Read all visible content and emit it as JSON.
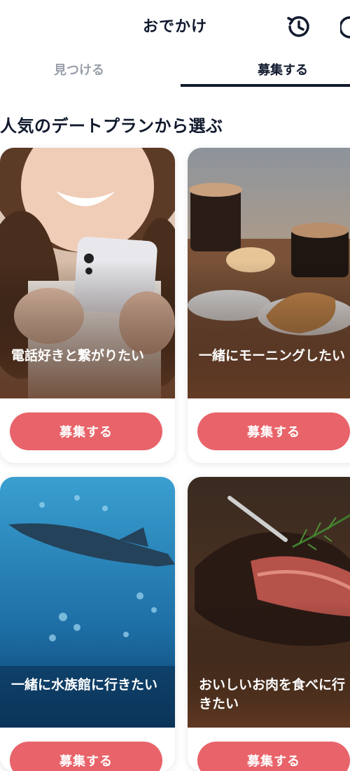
{
  "header": {
    "title": "おでかけ"
  },
  "tabs": [
    {
      "label": "見つける",
      "active": false
    },
    {
      "label": "募集する",
      "active": true
    }
  ],
  "section": {
    "title": "人気のデートプランから選ぶ"
  },
  "cards": [
    {
      "label": "電話好きと繋がりたい",
      "button": "募集する",
      "image": "woman-with-smartphone"
    },
    {
      "label": "一緒にモーニングしたい",
      "button": "募集する",
      "image": "coffee-and-croissant"
    },
    {
      "label": "一緒に水族館に行きたい",
      "button": "募集する",
      "image": "aquarium-whale-shark"
    },
    {
      "label": "おいしいお肉を食べに行きたい",
      "button": "募集する",
      "image": "grilled-steak"
    }
  ],
  "colors": {
    "accent": "#e8646a",
    "text": "#111a2e",
    "inactive_tab": "#9aa0ab"
  }
}
